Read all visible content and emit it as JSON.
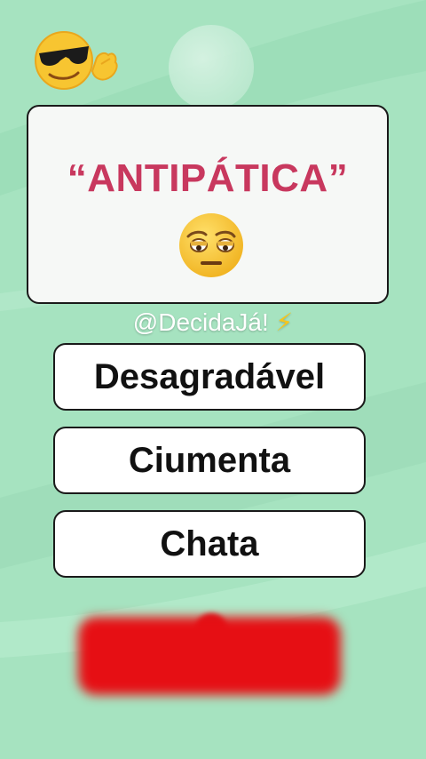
{
  "quiz": {
    "word": "“ANTIPÁTICA”",
    "options": [
      "Desagradável",
      "Ciumenta",
      "Chata"
    ]
  },
  "watermark": {
    "text": "@DecidaJá!",
    "bolt": "⚡"
  },
  "icons": {
    "mascot": "cool-sunglasses-emoji-icon",
    "word_face": "unamused-face-emoji-icon"
  },
  "colors": {
    "background": "#a6e3c0",
    "word": "#c8385e",
    "redacted_button": "#e60f14"
  }
}
